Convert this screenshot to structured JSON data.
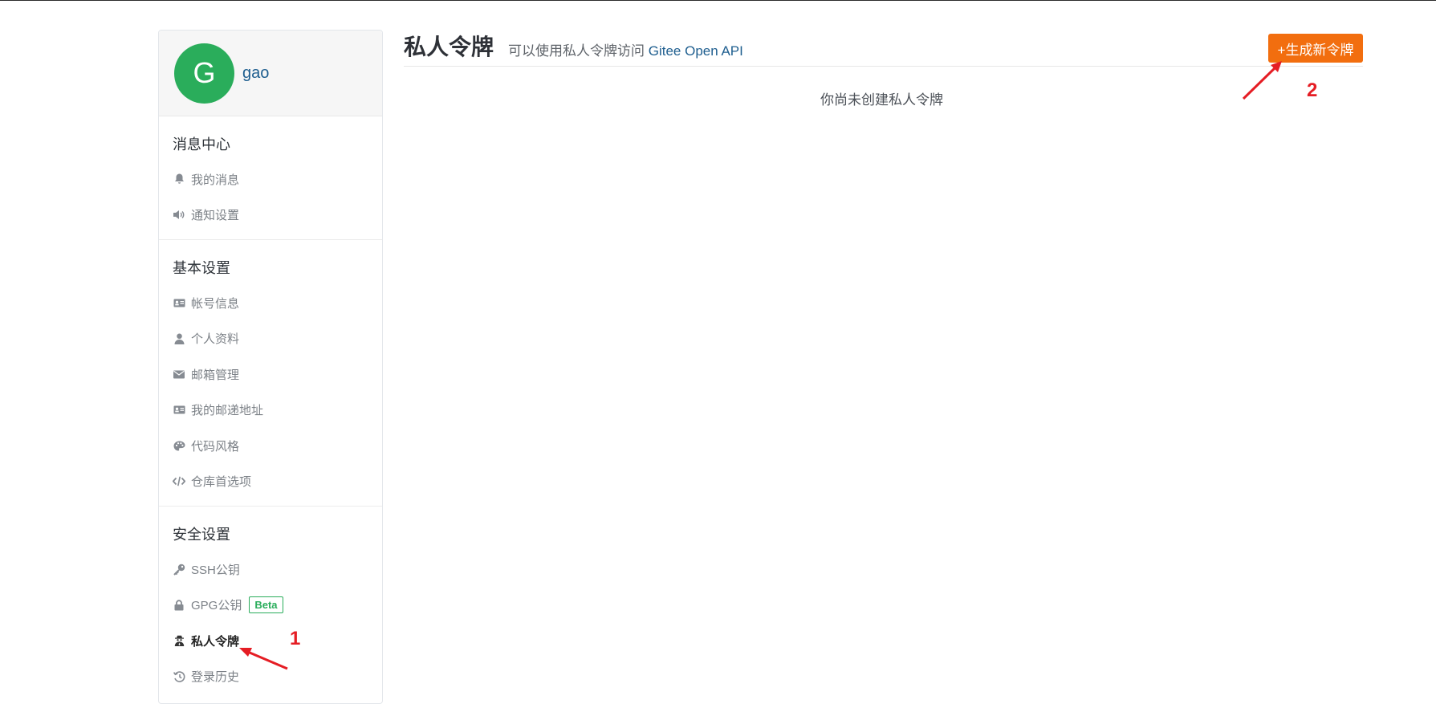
{
  "user": {
    "avatar_letter": "G",
    "name": "gao"
  },
  "sidebar": {
    "sections": [
      {
        "title": "消息中心",
        "items": [
          {
            "label": "我的消息",
            "icon": "bell-icon"
          },
          {
            "label": "通知设置",
            "icon": "volume-icon"
          }
        ]
      },
      {
        "title": "基本设置",
        "items": [
          {
            "label": "帐号信息",
            "icon": "id-card-icon"
          },
          {
            "label": "个人资料",
            "icon": "user-icon"
          },
          {
            "label": "邮箱管理",
            "icon": "envelope-icon"
          },
          {
            "label": "我的邮递地址",
            "icon": "address-card-icon"
          },
          {
            "label": "代码风格",
            "icon": "palette-icon"
          },
          {
            "label": "仓库首选项",
            "icon": "code-icon"
          }
        ]
      },
      {
        "title": "安全设置",
        "items": [
          {
            "label": "SSH公钥",
            "icon": "key-icon"
          },
          {
            "label": "GPG公钥",
            "icon": "lock-icon",
            "badge": "Beta"
          },
          {
            "label": "私人令牌",
            "icon": "user-secret-icon",
            "active": true
          },
          {
            "label": "登录历史",
            "icon": "history-icon"
          }
        ]
      }
    ]
  },
  "header": {
    "title": "私人令牌",
    "subtitle_prefix": "可以使用私人令牌访问",
    "subtitle_link": "Gitee Open API",
    "generate_button": "+生成新令牌"
  },
  "main": {
    "empty_message": "你尚未创建私人令牌"
  },
  "annotations": {
    "step1": "1",
    "step2": "2"
  },
  "colors": {
    "accent": "#f26e0f",
    "avatar": "#2aad5b",
    "link": "#1e5e8f",
    "annotation": "#e51d24"
  }
}
